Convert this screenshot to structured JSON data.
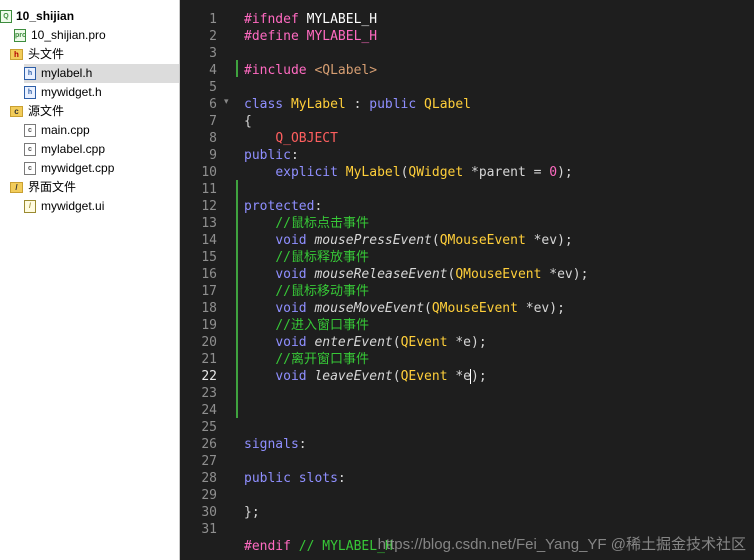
{
  "project_tree": {
    "root": "10_shijian",
    "pro_file": "10_shijian.pro",
    "headers_folder": "头文件",
    "headers": [
      "mylabel.h",
      "mywidget.h"
    ],
    "sources_folder": "源文件",
    "sources": [
      "main.cpp",
      "mylabel.cpp",
      "mywidget.cpp"
    ],
    "forms_folder": "界面文件",
    "forms": [
      "mywidget.ui"
    ],
    "selected": "mylabel.h"
  },
  "editor": {
    "current_line": 22,
    "lines": [
      "#ifndef MYLABEL_H",
      "#define MYLABEL_H",
      "",
      "#include <QLabel>",
      "",
      "class MyLabel : public QLabel",
      "{",
      "    Q_OBJECT",
      "public:",
      "    explicit MyLabel(QWidget *parent = 0);",
      "",
      "protected:",
      "    //鼠标点击事件",
      "    void mousePressEvent(QMouseEvent *ev);",
      "    //鼠标释放事件",
      "    void mouseReleaseEvent(QMouseEvent *ev);",
      "    //鼠标移动事件",
      "    void mouseMoveEvent(QMouseEvent *ev);",
      "    //进入窗口事件",
      "    void enterEvent(QEvent *e);",
      "    //离开窗口事件",
      "    void leaveEvent(QEvent *e);",
      "",
      "",
      "signals:",
      "",
      "public slots:",
      "",
      "};",
      "",
      "#endif // MYLABEL_H"
    ]
  },
  "watermark": "https://blog.csdn.net/Fei_Yang_YF @稀土掘金技术社区",
  "colors": {
    "editor_bg": "#1e1e1e",
    "preprocessor": "#ff6ac1",
    "keyword": "#8f8fff",
    "type": "#ffcf3a",
    "comment": "#37c837",
    "macro": "#ff5f5f",
    "selected_row": "#dcdcdc"
  }
}
